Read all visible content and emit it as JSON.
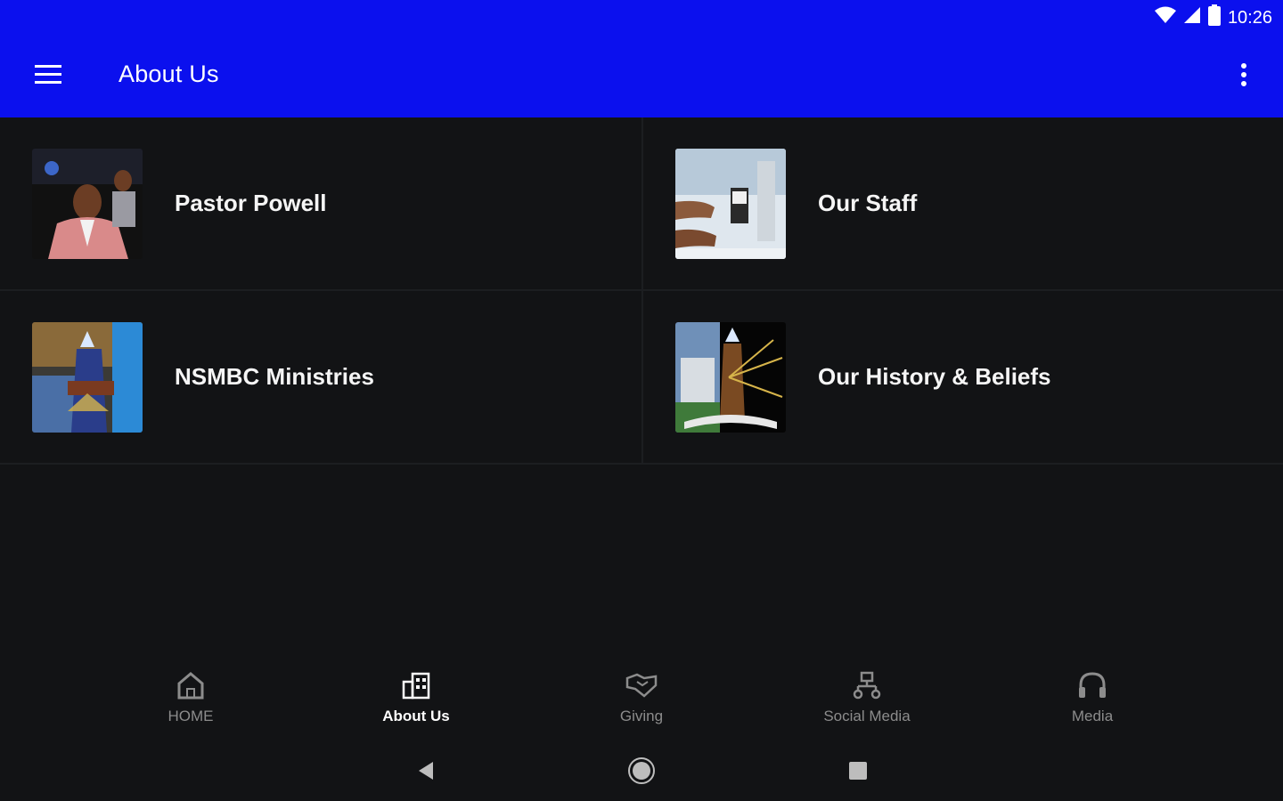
{
  "status": {
    "time": "10:26",
    "icons": [
      "wifi-icon",
      "signal-icon",
      "battery-icon"
    ]
  },
  "appbar": {
    "title": "About Us",
    "menu_icon": "hamburger-menu-icon",
    "more_icon": "more-vert-icon"
  },
  "tiles": [
    {
      "label": "Pastor Powell",
      "image": "pastor-photo"
    },
    {
      "label": "Our Staff",
      "image": "staff-photo"
    },
    {
      "label": "NSMBC Ministries",
      "image": "ministries-photo"
    },
    {
      "label": "Our History & Beliefs",
      "image": "history-photo"
    }
  ],
  "bottom_nav": [
    {
      "label": "HOME",
      "icon": "home-icon",
      "active": false
    },
    {
      "label": "About Us",
      "icon": "building-icon",
      "active": true
    },
    {
      "label": "Giving",
      "icon": "handshake-icon",
      "active": false
    },
    {
      "label": "Social Media",
      "icon": "network-icon",
      "active": false
    },
    {
      "label": "Media",
      "icon": "headphones-icon",
      "active": false
    }
  ],
  "system_nav": [
    "back-icon",
    "home-circle-icon",
    "recents-icon"
  ],
  "colors": {
    "brand_blue": "#0b10ee",
    "background": "#121315",
    "divider": "#1c1e21",
    "inactive_nav": "#8c8c8c"
  }
}
